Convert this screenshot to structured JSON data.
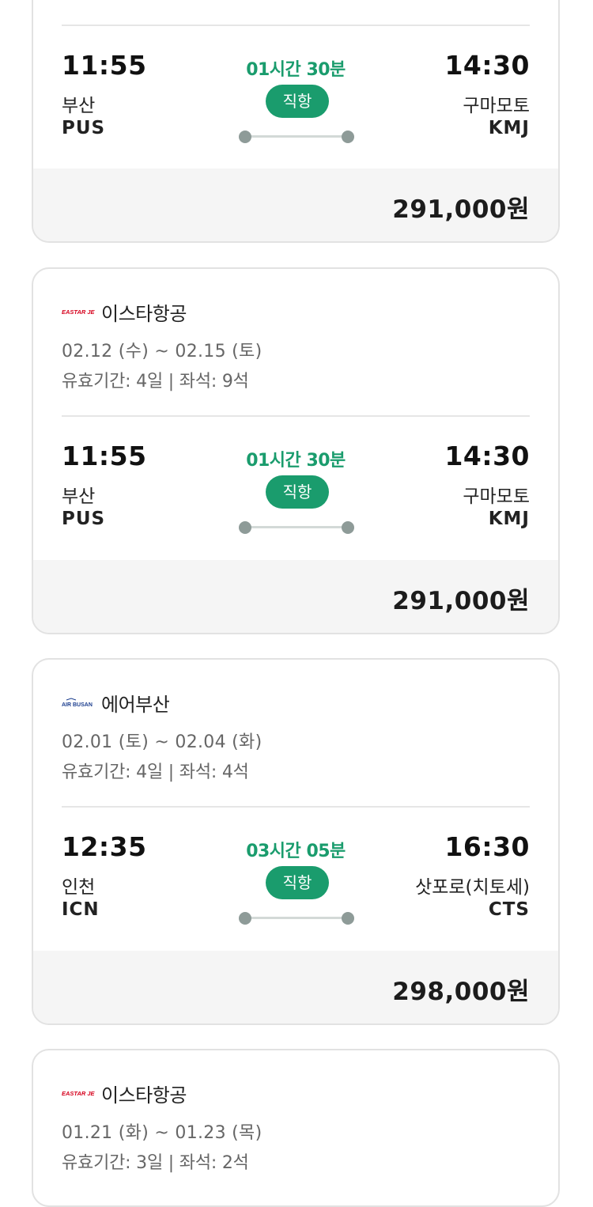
{
  "cards": [
    {
      "departure": {
        "time": "11:55",
        "city": "부산",
        "code": "PUS"
      },
      "arrival": {
        "time": "14:30",
        "city": "구마모토",
        "code": "KMJ"
      },
      "duration": "01시간 30분",
      "badge": "직항",
      "price": "291,000원"
    },
    {
      "airline": {
        "name": "이스타항공",
        "logo_icon": "eastarjet-logo",
        "logo_text": "EASTAR JET",
        "brand_color": "#d6001c"
      },
      "dates": "02.12 (수) ~ 02.15 (토)",
      "validity": "유효기간: 4일 | 좌석: 9석",
      "departure": {
        "time": "11:55",
        "city": "부산",
        "code": "PUS"
      },
      "arrival": {
        "time": "14:30",
        "city": "구마모토",
        "code": "KMJ"
      },
      "duration": "01시간 30분",
      "badge": "직항",
      "price": "291,000원"
    },
    {
      "airline": {
        "name": "에어부산",
        "logo_icon": "airbusan-logo",
        "logo_text": "AIR BUSAN",
        "brand_color": "#1d3f8f"
      },
      "dates": "02.01 (토) ~ 02.04 (화)",
      "validity": "유효기간: 4일 | 좌석: 4석",
      "departure": {
        "time": "12:35",
        "city": "인천",
        "code": "ICN"
      },
      "arrival": {
        "time": "16:30",
        "city": "삿포로(치토세)",
        "code": "CTS"
      },
      "duration": "03시간 05분",
      "badge": "직항",
      "price": "298,000원"
    },
    {
      "airline": {
        "name": "이스타항공",
        "logo_icon": "eastarjet-logo",
        "logo_text": "EASTAR JET",
        "brand_color": "#d6001c"
      },
      "dates": "01.21 (화) ~ 01.23 (목)",
      "validity": "유효기간: 3일 | 좌석: 2석"
    }
  ],
  "colors": {
    "accent_green": "#1a9c6d",
    "price_bar_bg": "#f5f5f5",
    "border": "#e2e2e2"
  }
}
